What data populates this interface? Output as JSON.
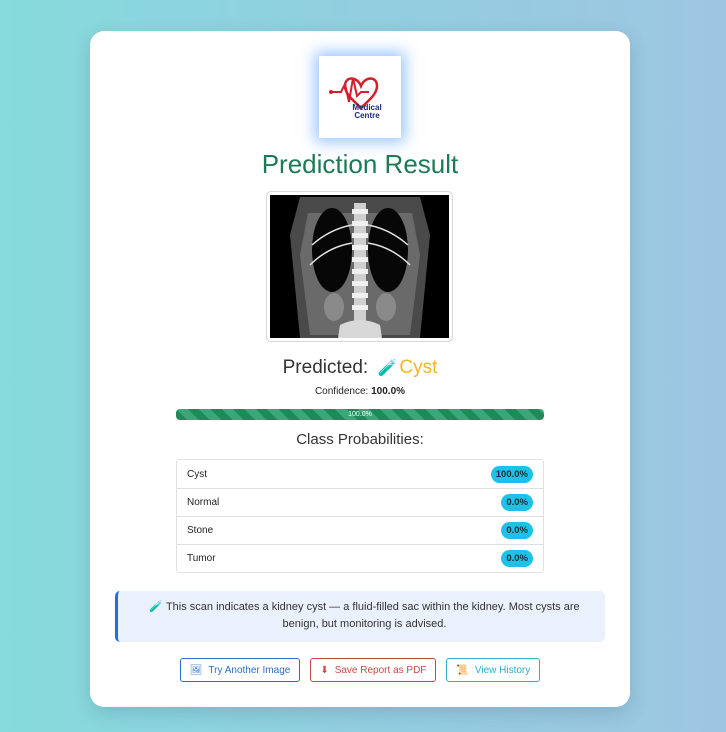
{
  "logo": {
    "line1": "Medical",
    "line2": "Centre"
  },
  "page": {
    "title": "Prediction Result"
  },
  "prediction": {
    "label": "Predicted:",
    "icon": "test-tube-icon",
    "class_name": "Cyst",
    "confidence_label": "Confidence:",
    "confidence_value": "100.0%",
    "progress_text": "100.0%",
    "progress_fraction": 1.0
  },
  "probabilities": {
    "title": "Class Probabilities:",
    "rows": [
      {
        "name": "Cyst",
        "value": "100.0%"
      },
      {
        "name": "Normal",
        "value": "0.0%"
      },
      {
        "name": "Stone",
        "value": "0.0%"
      },
      {
        "name": "Tumor",
        "value": "0.0%"
      }
    ]
  },
  "info": {
    "icon": "test-tube-icon",
    "text": "This scan indicates a kidney cyst — a fluid-filled sac within the kidney. Most cysts are benign, but monitoring is advised."
  },
  "buttons": {
    "try_another": {
      "label": "Try Another Image",
      "icon": "image-icon"
    },
    "save_pdf": {
      "label": "Save Report as PDF",
      "icon": "download-icon"
    },
    "history": {
      "label": "View History",
      "icon": "scroll-icon"
    }
  },
  "colors": {
    "title_green": "#1e7a55",
    "class_yellow": "#f2b624",
    "badge_cyan": "#1ec1e8",
    "progress_green": "#1e8a5a"
  }
}
